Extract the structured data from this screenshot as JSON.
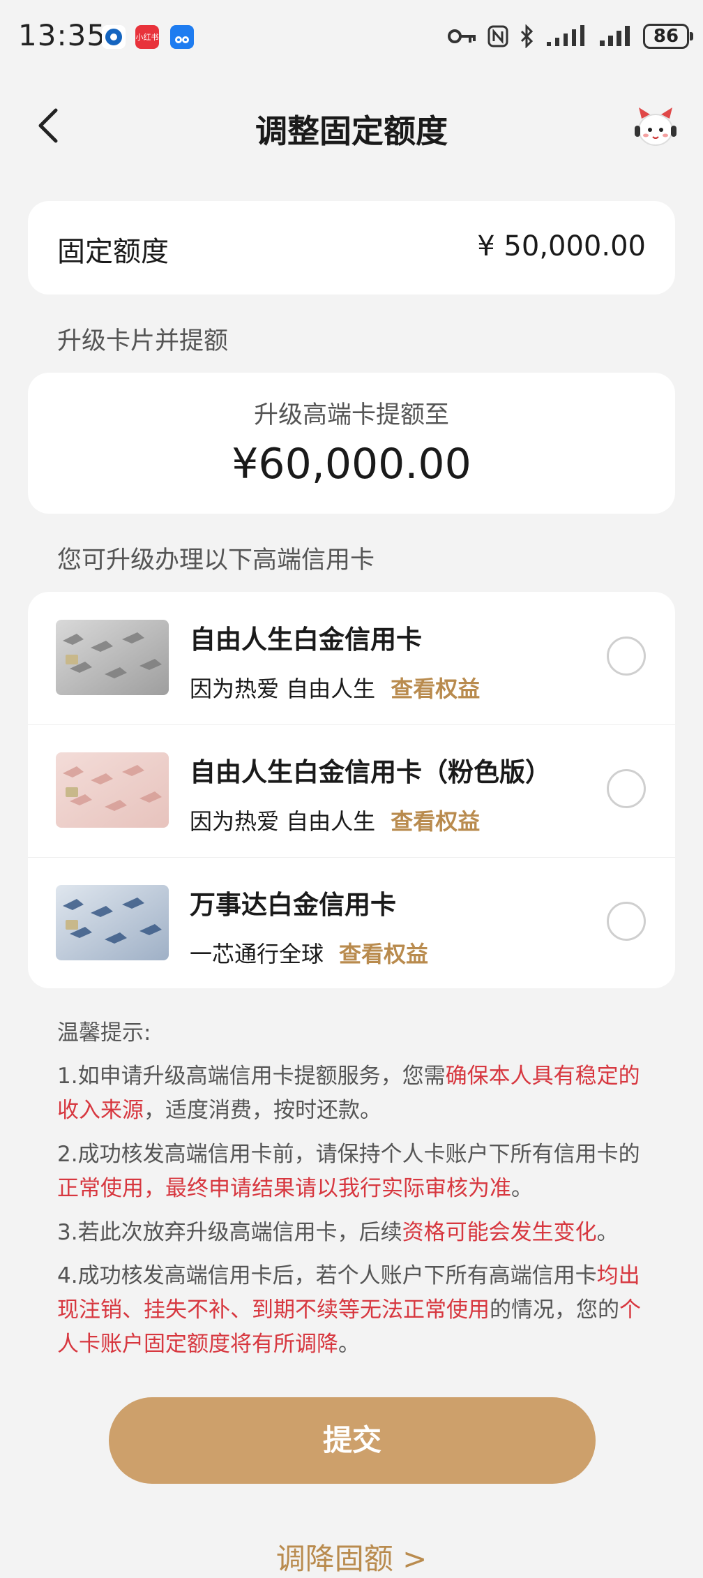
{
  "status_bar": {
    "time": "13:35",
    "app_icons": [
      "bank-app-icon",
      "xiaohongshu-icon",
      "autohome-icon"
    ],
    "app_icon_labels": {
      "xiaohongshu": "小红书",
      "autohome": "汽车之家"
    },
    "battery": "86"
  },
  "header": {
    "title": "调整固定额度"
  },
  "fixed_limit": {
    "label": "固定额度",
    "value": "¥ 50,000.00"
  },
  "upgrade_section": {
    "label": "升级卡片并提额",
    "subtitle": "升级高端卡提额至",
    "amount": "¥60,000.00"
  },
  "cards_section": {
    "label": "您可升级办理以下高端信用卡",
    "cards": [
      {
        "name": "自由人生白金信用卡",
        "desc": "因为热爱 自由人生",
        "link": "查看权益"
      },
      {
        "name": "自由人生白金信用卡（粉色版）",
        "desc": "因为热爱 自由人生",
        "link": "查看权益"
      },
      {
        "name": "万事达白金信用卡",
        "desc": "一芯通行全球",
        "link": "查看权益"
      }
    ]
  },
  "tips": {
    "heading": "温馨提示:",
    "t1": {
      "a": "1.如申请升级高端信用卡提额服务，您需",
      "b": "确保本人具有稳定的收入来源",
      "c": "，适度消费，按时还款。"
    },
    "t2": {
      "a": "2.成功核发高端信用卡前，请保持个人卡账户下所有信用卡的",
      "b": "正常使用，最终申请结果请以我行实际审核为准",
      "c": "。"
    },
    "t3": {
      "a": "3.若此次放弃升级高端信用卡，后续",
      "b": "资格可能会发生变化",
      "c": "。"
    },
    "t4": {
      "a": "4.成功核发高端信用卡后，若个人账户下所有高端信用卡",
      "b": "均出现注销、挂失不补、到期不续等无法正常使用",
      "c": "的情况，您的",
      "d": "个人卡账户固定额度将有所调降",
      "e": "。"
    }
  },
  "actions": {
    "submit": "提交",
    "reduce": "调降固额 >"
  },
  "colors": {
    "accent": "#cda06b",
    "link": "#b98b4e",
    "highlight": "#d7373f",
    "background": "#f3f3f3"
  }
}
